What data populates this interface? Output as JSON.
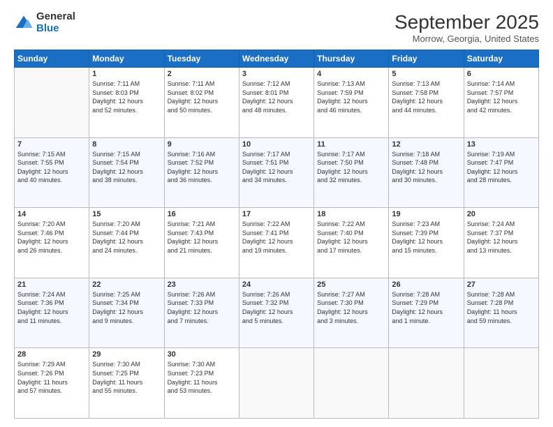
{
  "logo": {
    "general": "General",
    "blue": "Blue"
  },
  "header": {
    "month": "September 2025",
    "location": "Morrow, Georgia, United States"
  },
  "days": [
    "Sunday",
    "Monday",
    "Tuesday",
    "Wednesday",
    "Thursday",
    "Friday",
    "Saturday"
  ],
  "weeks": [
    [
      {
        "day": "",
        "info": ""
      },
      {
        "day": "1",
        "info": "Sunrise: 7:11 AM\nSunset: 8:03 PM\nDaylight: 12 hours\nand 52 minutes."
      },
      {
        "day": "2",
        "info": "Sunrise: 7:11 AM\nSunset: 8:02 PM\nDaylight: 12 hours\nand 50 minutes."
      },
      {
        "day": "3",
        "info": "Sunrise: 7:12 AM\nSunset: 8:01 PM\nDaylight: 12 hours\nand 48 minutes."
      },
      {
        "day": "4",
        "info": "Sunrise: 7:13 AM\nSunset: 7:59 PM\nDaylight: 12 hours\nand 46 minutes."
      },
      {
        "day": "5",
        "info": "Sunrise: 7:13 AM\nSunset: 7:58 PM\nDaylight: 12 hours\nand 44 minutes."
      },
      {
        "day": "6",
        "info": "Sunrise: 7:14 AM\nSunset: 7:57 PM\nDaylight: 12 hours\nand 42 minutes."
      }
    ],
    [
      {
        "day": "7",
        "info": "Sunrise: 7:15 AM\nSunset: 7:55 PM\nDaylight: 12 hours\nand 40 minutes."
      },
      {
        "day": "8",
        "info": "Sunrise: 7:15 AM\nSunset: 7:54 PM\nDaylight: 12 hours\nand 38 minutes."
      },
      {
        "day": "9",
        "info": "Sunrise: 7:16 AM\nSunset: 7:52 PM\nDaylight: 12 hours\nand 36 minutes."
      },
      {
        "day": "10",
        "info": "Sunrise: 7:17 AM\nSunset: 7:51 PM\nDaylight: 12 hours\nand 34 minutes."
      },
      {
        "day": "11",
        "info": "Sunrise: 7:17 AM\nSunset: 7:50 PM\nDaylight: 12 hours\nand 32 minutes."
      },
      {
        "day": "12",
        "info": "Sunrise: 7:18 AM\nSunset: 7:48 PM\nDaylight: 12 hours\nand 30 minutes."
      },
      {
        "day": "13",
        "info": "Sunrise: 7:19 AM\nSunset: 7:47 PM\nDaylight: 12 hours\nand 28 minutes."
      }
    ],
    [
      {
        "day": "14",
        "info": "Sunrise: 7:20 AM\nSunset: 7:46 PM\nDaylight: 12 hours\nand 26 minutes."
      },
      {
        "day": "15",
        "info": "Sunrise: 7:20 AM\nSunset: 7:44 PM\nDaylight: 12 hours\nand 24 minutes."
      },
      {
        "day": "16",
        "info": "Sunrise: 7:21 AM\nSunset: 7:43 PM\nDaylight: 12 hours\nand 21 minutes."
      },
      {
        "day": "17",
        "info": "Sunrise: 7:22 AM\nSunset: 7:41 PM\nDaylight: 12 hours\nand 19 minutes."
      },
      {
        "day": "18",
        "info": "Sunrise: 7:22 AM\nSunset: 7:40 PM\nDaylight: 12 hours\nand 17 minutes."
      },
      {
        "day": "19",
        "info": "Sunrise: 7:23 AM\nSunset: 7:39 PM\nDaylight: 12 hours\nand 15 minutes."
      },
      {
        "day": "20",
        "info": "Sunrise: 7:24 AM\nSunset: 7:37 PM\nDaylight: 12 hours\nand 13 minutes."
      }
    ],
    [
      {
        "day": "21",
        "info": "Sunrise: 7:24 AM\nSunset: 7:36 PM\nDaylight: 12 hours\nand 11 minutes."
      },
      {
        "day": "22",
        "info": "Sunrise: 7:25 AM\nSunset: 7:34 PM\nDaylight: 12 hours\nand 9 minutes."
      },
      {
        "day": "23",
        "info": "Sunrise: 7:26 AM\nSunset: 7:33 PM\nDaylight: 12 hours\nand 7 minutes."
      },
      {
        "day": "24",
        "info": "Sunrise: 7:26 AM\nSunset: 7:32 PM\nDaylight: 12 hours\nand 5 minutes."
      },
      {
        "day": "25",
        "info": "Sunrise: 7:27 AM\nSunset: 7:30 PM\nDaylight: 12 hours\nand 3 minutes."
      },
      {
        "day": "26",
        "info": "Sunrise: 7:28 AM\nSunset: 7:29 PM\nDaylight: 12 hours\nand 1 minute."
      },
      {
        "day": "27",
        "info": "Sunrise: 7:28 AM\nSunset: 7:28 PM\nDaylight: 11 hours\nand 59 minutes."
      }
    ],
    [
      {
        "day": "28",
        "info": "Sunrise: 7:29 AM\nSunset: 7:26 PM\nDaylight: 11 hours\nand 57 minutes."
      },
      {
        "day": "29",
        "info": "Sunrise: 7:30 AM\nSunset: 7:25 PM\nDaylight: 11 hours\nand 55 minutes."
      },
      {
        "day": "30",
        "info": "Sunrise: 7:30 AM\nSunset: 7:23 PM\nDaylight: 11 hours\nand 53 minutes."
      },
      {
        "day": "",
        "info": ""
      },
      {
        "day": "",
        "info": ""
      },
      {
        "day": "",
        "info": ""
      },
      {
        "day": "",
        "info": ""
      }
    ]
  ]
}
